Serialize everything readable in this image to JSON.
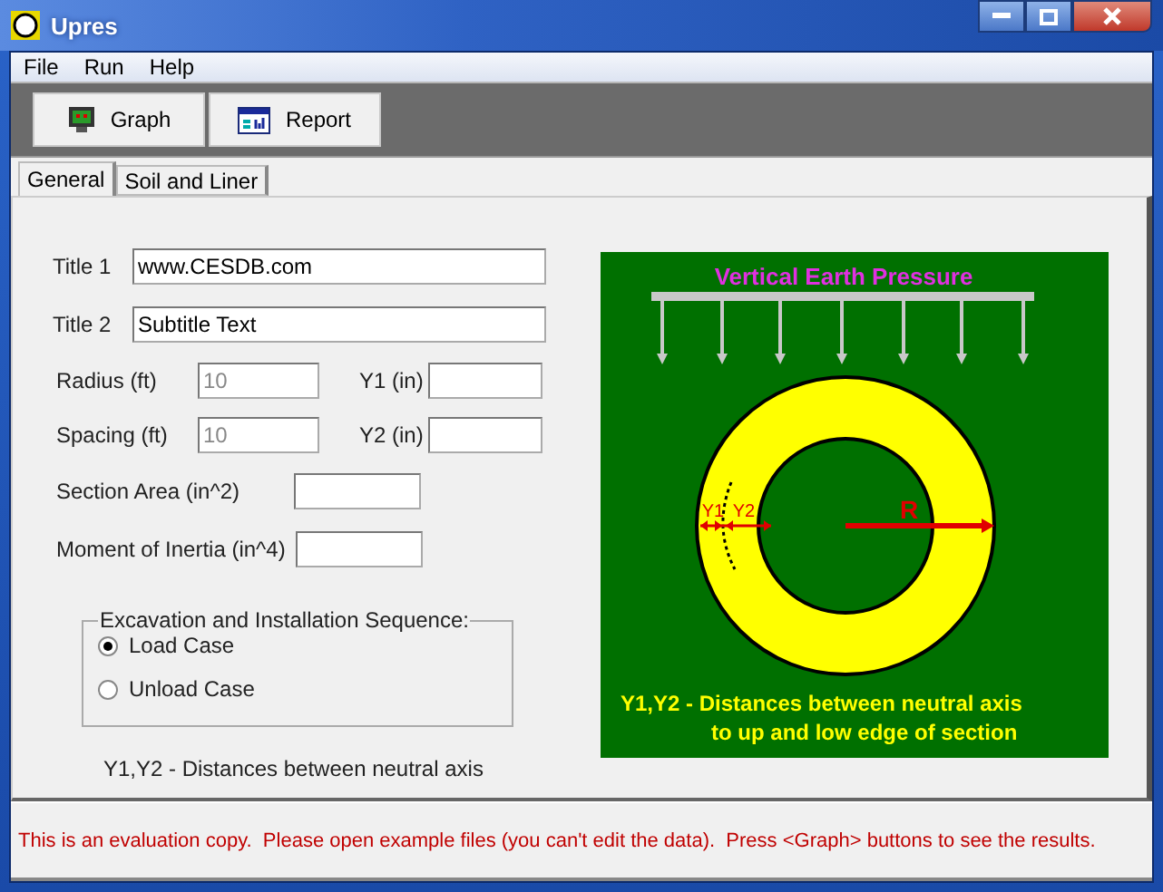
{
  "window": {
    "title": "Upres"
  },
  "menu": [
    "File",
    "Run",
    "Help"
  ],
  "toolbar": [
    {
      "label": "Graph",
      "kind": "graph"
    },
    {
      "label": "Report",
      "kind": "report"
    }
  ],
  "tabs": [
    {
      "label": "General",
      "selected": true
    },
    {
      "label": "Soil and Liner",
      "selected": false
    }
  ],
  "form": {
    "title_1": {
      "label": "Title 1",
      "value": "www.CESDB.com"
    },
    "title_2": {
      "label": "Title 2",
      "value": "Subtitle Text"
    },
    "radius": {
      "label": "Radius (ft)",
      "value": "10",
      "disabled": true
    },
    "y1": {
      "label": "Y1 (in)"
    },
    "spacing": {
      "label": "Spacing (ft)",
      "value": "10",
      "disabled": true
    },
    "y2": {
      "label": "Y2 (in)"
    },
    "section_area": {
      "label": "Section Area (in^2)"
    },
    "moment_of_inertia": {
      "label": "Moment of Inertia (in^4)"
    }
  },
  "sequence": {
    "legend": "Excavation and Installation Sequence:",
    "options": [
      {
        "label": "Load Case",
        "selected": true
      },
      {
        "label": "Unload Case",
        "selected": false
      }
    ]
  },
  "note": "Y1,Y2 - Distances between neutral axis",
  "diagram": {
    "title": "Vertical Earth Pressure",
    "y1_label": "Y1",
    "y2_label": "Y2",
    "radius_label": "R",
    "caption": [
      "Y1,Y2 - Distances between neutral axis",
      "to up and low edge of section"
    ]
  },
  "status": "This is an evaluation copy.  Please open example files (you can't edit the data).  Press <Graph> buttons to see the results."
}
